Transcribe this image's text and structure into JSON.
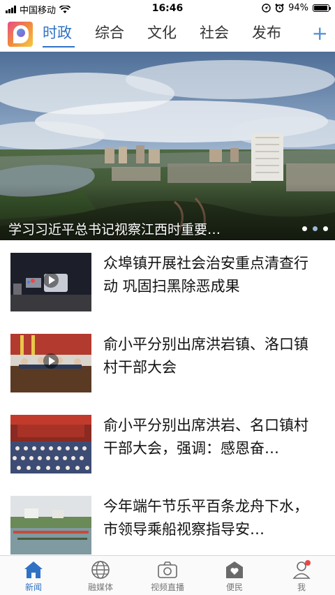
{
  "status_bar": {
    "carrier": "中国移动",
    "time": "16:46",
    "battery": "94%",
    "battery_level": 0.94,
    "icons": [
      "signal-icon",
      "wifi-icon",
      "location-icon",
      "alarm-icon",
      "battery-icon"
    ]
  },
  "top_nav": {
    "tabs": [
      {
        "label": "时政",
        "active": true
      },
      {
        "label": "综合",
        "active": false
      },
      {
        "label": "文化",
        "active": false
      },
      {
        "label": "社会",
        "active": false
      },
      {
        "label": "发布",
        "active": false
      }
    ],
    "add_label": "+",
    "accent_color": "#2f72c4"
  },
  "banner": {
    "caption": "学习习近平总书记视察江西时重要…",
    "slide_count": 3,
    "active_slide": 2
  },
  "news": [
    {
      "title": "众埠镇开展社会治安重点清查行动 巩固扫黑除恶成果",
      "has_video": true
    },
    {
      "title": "俞小平分别出席洪岩镇、洛口镇村干部大会",
      "has_video": true
    },
    {
      "title": "俞小平分别出席洪岩、名口镇村干部大会，强调：感恩奋…",
      "has_video": false
    },
    {
      "title": "今年端午节乐平百条龙舟下水，市领导乘船视察指导安…",
      "has_video": false
    }
  ],
  "bottom_nav": {
    "items": [
      {
        "label": "新闻",
        "icon": "home-icon",
        "active": true
      },
      {
        "label": "融媒体",
        "icon": "globe-icon",
        "active": false
      },
      {
        "label": "视频直播",
        "icon": "camera-icon",
        "active": false
      },
      {
        "label": "便民",
        "icon": "house-heart-icon",
        "active": false
      },
      {
        "label": "我",
        "icon": "user-icon",
        "active": false,
        "badge": true
      }
    ]
  }
}
